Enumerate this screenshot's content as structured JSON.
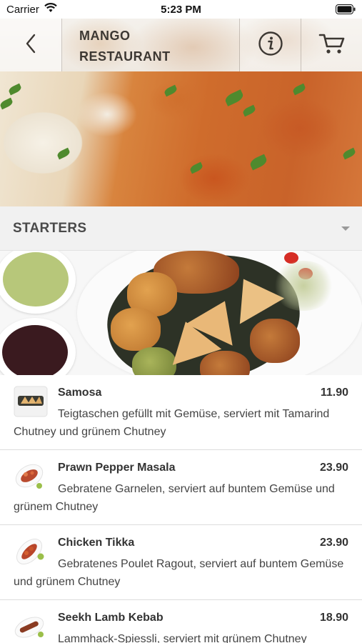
{
  "status_bar": {
    "carrier": "Carrier",
    "time": "5:23 PM"
  },
  "header": {
    "title_line1": "MANGO",
    "title_line2": "RESTAURANT",
    "back_icon": "chevron-left-icon",
    "info_icon": "info-circle-icon",
    "cart_icon": "cart-icon"
  },
  "section": {
    "title": "STARTERS",
    "toggle_icon": "caret-down-icon"
  },
  "menu_items": [
    {
      "name": "Samosa",
      "price": "11.90",
      "description": "Teigtaschen gefüllt mit Gemüse, serviert mit Tamarind Chutney und grünem Chutney"
    },
    {
      "name": "Prawn Pepper Masala",
      "price": "23.90",
      "description": "Gebratene Garnelen, serviert auf buntem Gemüse und grünem Chutney"
    },
    {
      "name": "Chicken Tikka",
      "price": "23.90",
      "description": "Gebratenes Poulet Ragout, serviert auf buntem Gemüse und grünem Chutney"
    },
    {
      "name": "Seekh Lamb Kebab",
      "price": "18.90",
      "description": "Lammhack-Spiessli, serviert mit grünem Chutney"
    }
  ],
  "colors": {
    "section_bg": "#f1f1f1",
    "text_dark": "#333333",
    "divider": "#dcdcdc"
  }
}
